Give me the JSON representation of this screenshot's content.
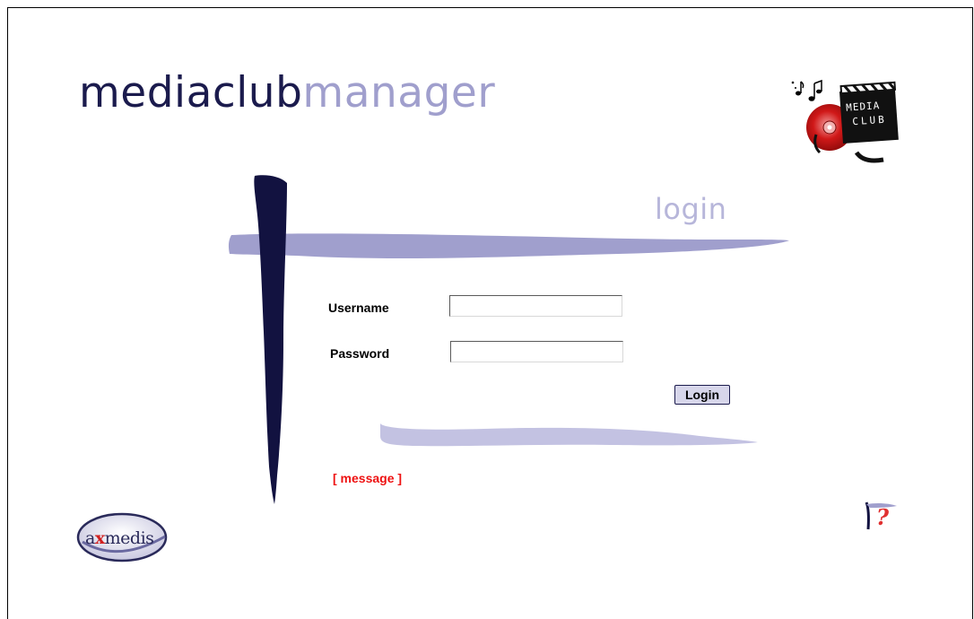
{
  "header": {
    "brand_part1": "mediaclub",
    "brand_part2": "manager",
    "media_club_logo_line1": "MEDIA",
    "media_club_logo_line2": "CLUB"
  },
  "login": {
    "heading": "login",
    "username_label": "Username",
    "username_value": "",
    "password_label": "Password",
    "password_value": "",
    "button_label": "Login",
    "message": "[ message ]"
  },
  "footer": {
    "axmedis_prefix": "a",
    "axmedis_x": "x",
    "axmedis_suffix": "medis",
    "help_symbol": "?"
  },
  "colors": {
    "navy": "#1b1b4d",
    "lavender": "#a09fcd",
    "light_lavender": "#c3c2e2",
    "message_red": "#ee1111"
  },
  "icons": [
    "media-club-logo-icon",
    "music-notes-icon",
    "axmedis-logo-icon",
    "help-icon"
  ]
}
